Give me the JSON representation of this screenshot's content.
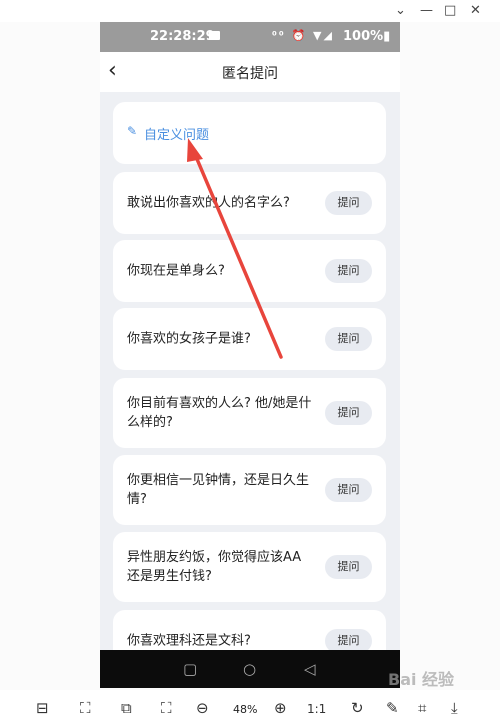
{
  "window": {
    "minimize": "⌄",
    "min": "—",
    "max": "□",
    "close": "✕"
  },
  "phone": {
    "status": {
      "time": "22:28:29",
      "icons": "⁰⁰ ⏰ ▼◢",
      "battery": "100%▮"
    },
    "header": {
      "back": "‹",
      "title": "匿名提问"
    },
    "custom_question": {
      "label": "自定义问题",
      "icon": "pencil-icon"
    },
    "ask_label": "提问",
    "questions": [
      {
        "text": "敢说出你喜欢的人的名字么?"
      },
      {
        "text": "你现在是单身么?"
      },
      {
        "text": "你喜欢的女孩子是谁?"
      },
      {
        "text": "你目前有喜欢的人么? 他/她是什么样的?"
      },
      {
        "text": "你更相信一见钟情，还是日久生情?"
      },
      {
        "text": "异性朋友约饭，你觉得应该AA还是男生付钱?"
      },
      {
        "text": "你喜欢理科还是文科?"
      }
    ],
    "accent": "#4a8fe0",
    "arrow_color": "#e8453c"
  },
  "toolbar": {
    "zoom": "48%",
    "one_to_one": "1:1",
    "watermark": "Bai 经验"
  }
}
